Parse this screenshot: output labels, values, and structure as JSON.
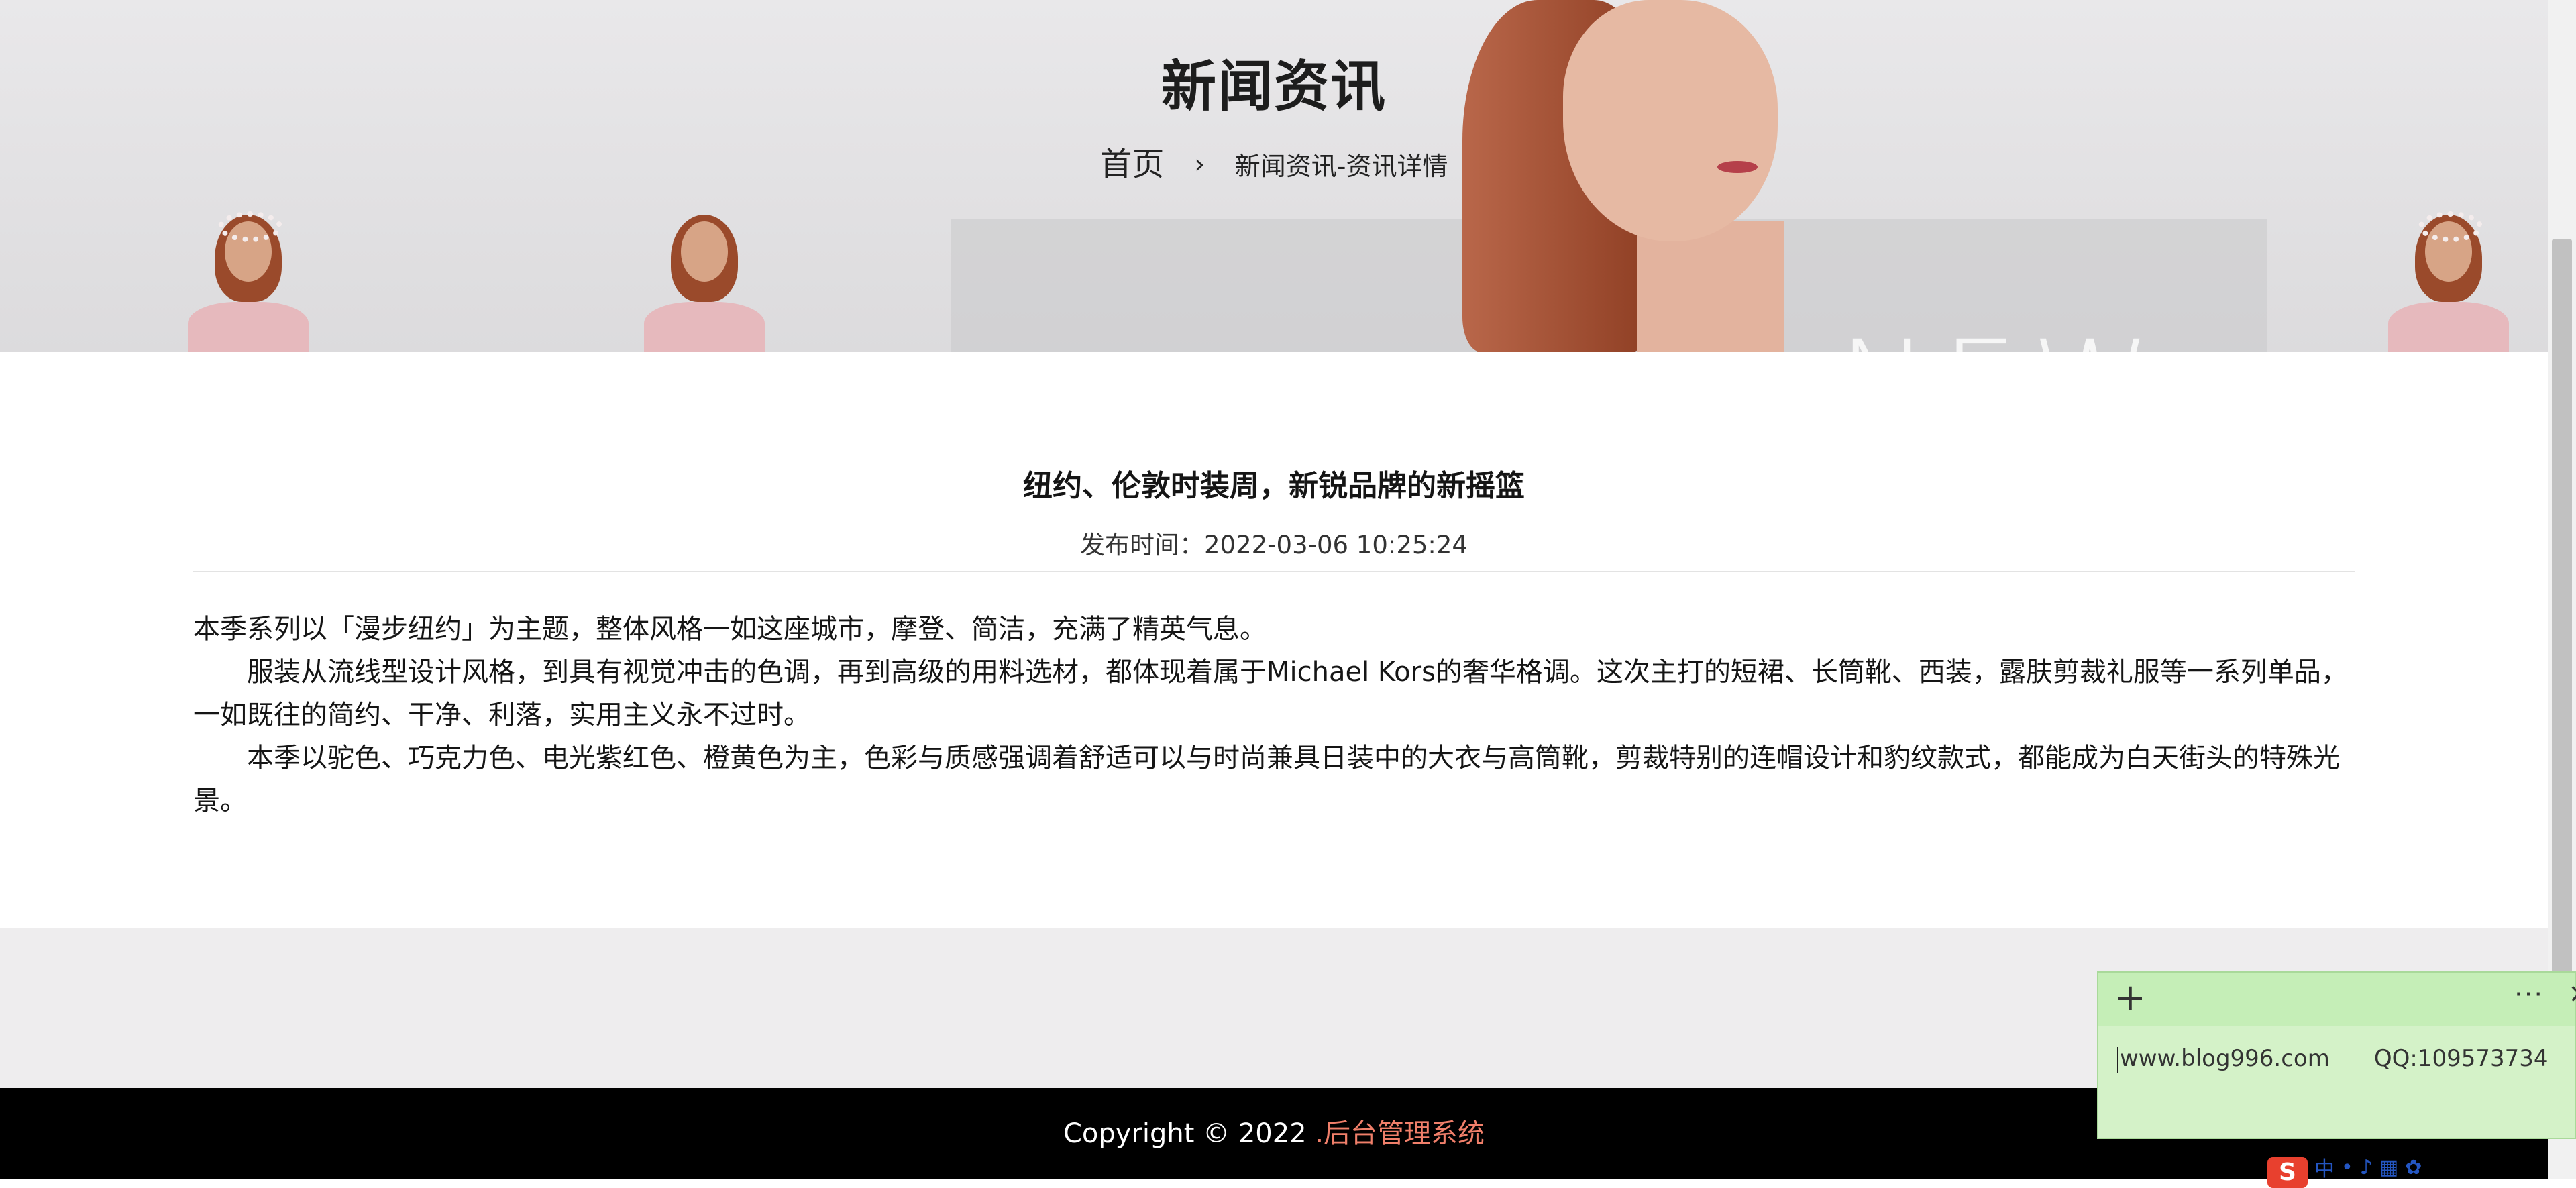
{
  "hero": {
    "title": "新闻资讯",
    "breadcrumb": {
      "home": "首页",
      "separator": "›",
      "current": "新闻资讯-资讯详情"
    }
  },
  "article": {
    "title": "纽约、伦敦时装周，新锐品牌的新摇篮",
    "date": "发布时间：2022-03-06 10:25:24",
    "paragraphs": [
      "本季系列以「漫步纽约」为主题，整体风格一如这座城市，摩登、简洁，充满了精英气息。",
      "服装从流线型设计风格，到具有视觉冲击的色调，再到高级的用料选材，都体现着属于Michael Kors的奢华格调。这次主打的短裙、长筒靴、西装，露肤剪裁礼服等一系列单品，一如既往的简约、干净、利落，实用主义永不过时。",
      "本季以驼色、巧克力色、电光紫红色、橙黄色为主，色彩与质感强调着舒适可以与时尚兼具日装中的大衣与高筒靴，剪裁特别的连帽设计和豹纹款式，都能成为白天街头的特殊光景。"
    ]
  },
  "footer": {
    "copyright": "Copyright © 2022 ",
    "link": ".后台管理系统"
  },
  "sticky_note": {
    "add": "+",
    "more": "···",
    "close": "×",
    "website": "www.blog996.com",
    "qq": "QQ:109573734"
  },
  "ime_tray": {
    "logo": "S",
    "lang": "中"
  },
  "colors": {
    "footer_bg": "#000000",
    "footer_link": "#f07f6a",
    "sticky_bg": "#d4f2c8"
  }
}
